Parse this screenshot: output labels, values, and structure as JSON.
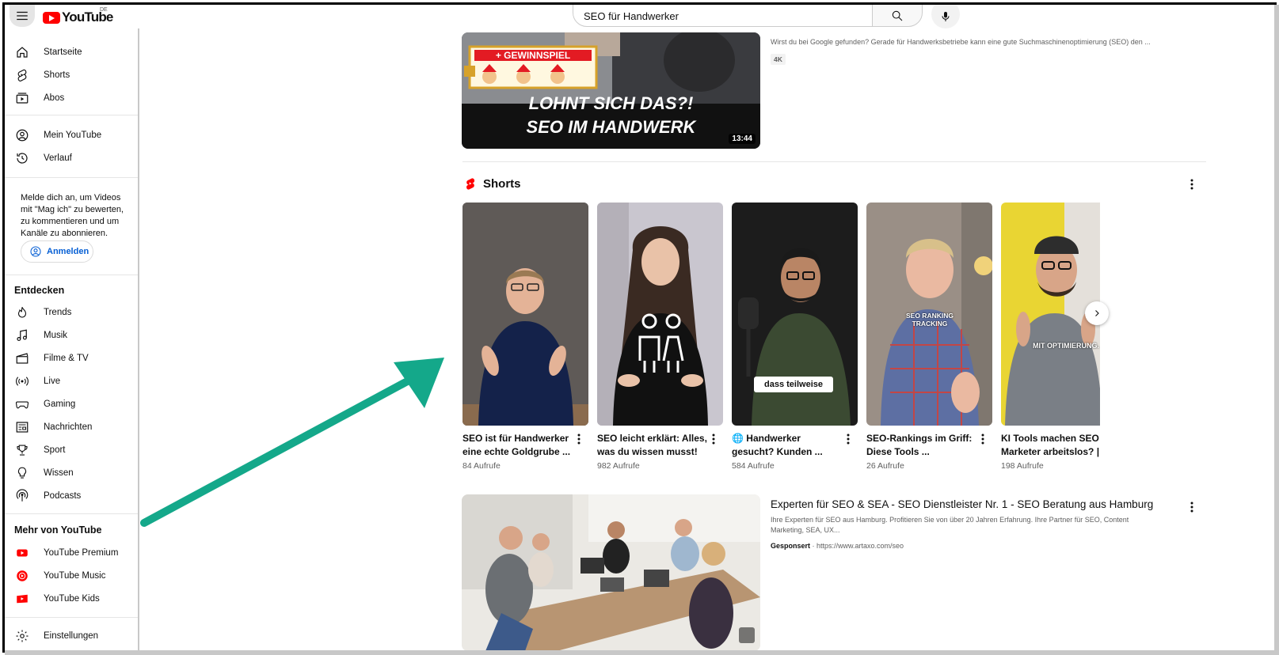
{
  "topbar": {
    "logo_text": "YouTube",
    "country_code": "DE",
    "search_value": "SEO für Handwerker"
  },
  "sidebar": {
    "items_top": [
      {
        "label": "Startseite",
        "icon": "home-icon"
      },
      {
        "label": "Shorts",
        "icon": "shorts-icon"
      },
      {
        "label": "Abos",
        "icon": "subscriptions-icon"
      }
    ],
    "items_you": [
      {
        "label": "Mein YouTube",
        "icon": "account-icon"
      },
      {
        "label": "Verlauf",
        "icon": "history-icon"
      }
    ],
    "signin_text": "Melde dich an, um Videos mit \"Mag ich\" zu bewerten, zu kommentieren und um Kanäle zu abonnieren.",
    "signin_button": "Anmelden",
    "explore_heading": "Entdecken",
    "explore_items": [
      {
        "label": "Trends",
        "icon": "trending-icon"
      },
      {
        "label": "Musik",
        "icon": "music-icon"
      },
      {
        "label": "Filme & TV",
        "icon": "movies-icon"
      },
      {
        "label": "Live",
        "icon": "live-icon"
      },
      {
        "label": "Gaming",
        "icon": "gaming-icon"
      },
      {
        "label": "Nachrichten",
        "icon": "news-icon"
      },
      {
        "label": "Sport",
        "icon": "sport-icon"
      },
      {
        "label": "Wissen",
        "icon": "learning-icon"
      },
      {
        "label": "Podcasts",
        "icon": "podcast-icon"
      }
    ],
    "more_heading": "Mehr von YouTube",
    "more_items": [
      {
        "label": "YouTube Premium",
        "icon": "youtube-premium-icon"
      },
      {
        "label": "YouTube Music",
        "icon": "youtube-music-icon"
      },
      {
        "label": "YouTube Kids",
        "icon": "youtube-kids-icon"
      }
    ],
    "settings_label": "Einstellungen"
  },
  "top_video": {
    "thumb_badge": "+ GEWINNSPIEL",
    "thumb_line1": "LOHNT SICH DAS?!",
    "thumb_line2": "SEO IM HANDWERK",
    "duration": "13:44",
    "description": "Wirst du bei Google gefunden? Gerade für Handwerksbetriebe kann eine gute Suchmaschinenoptimierung (SEO) den ...",
    "badge": "4K"
  },
  "shorts": {
    "heading": "Shorts",
    "items": [
      {
        "title": "SEO ist für Handwerker eine echte Goldgrube ...",
        "views": "84 Aufrufe",
        "overlay": ""
      },
      {
        "title": "SEO leicht erklärt: Alles, was du wissen musst!",
        "views": "982 Aufrufe",
        "overlay": ""
      },
      {
        "title": "🌐 Handwerker gesucht? Kunden ...",
        "views": "584 Aufrufe",
        "overlay": "dass teilweise"
      },
      {
        "title": "SEO-Rankings im Griff: Diese Tools ...",
        "views": "26 Aufrufe",
        "overlay": "SEO RANKING TRACKING"
      },
      {
        "title": "KI Tools machen SEO Marketer arbeitslos? | ...",
        "views": "198 Aufrufe",
        "overlay": "MIT OPTIMIERUNG."
      }
    ]
  },
  "ad": {
    "title": "Experten für SEO & SEA - SEO Dienstleister Nr. 1 - SEO Beratung aus Hamburg",
    "description": "Ihre Experten für SEO aus Hamburg. Profitieren Sie von über 20 Jahren Erfahrung. Ihre Partner für SEO, Content Marketing, SEA, UX...",
    "sponsored": "Gesponsert",
    "url": "https://www.artaxo.com/seo"
  },
  "colors": {
    "brand_red": "#ff0000",
    "link_blue": "#065fd4",
    "arrow_green": "#14a88a"
  }
}
